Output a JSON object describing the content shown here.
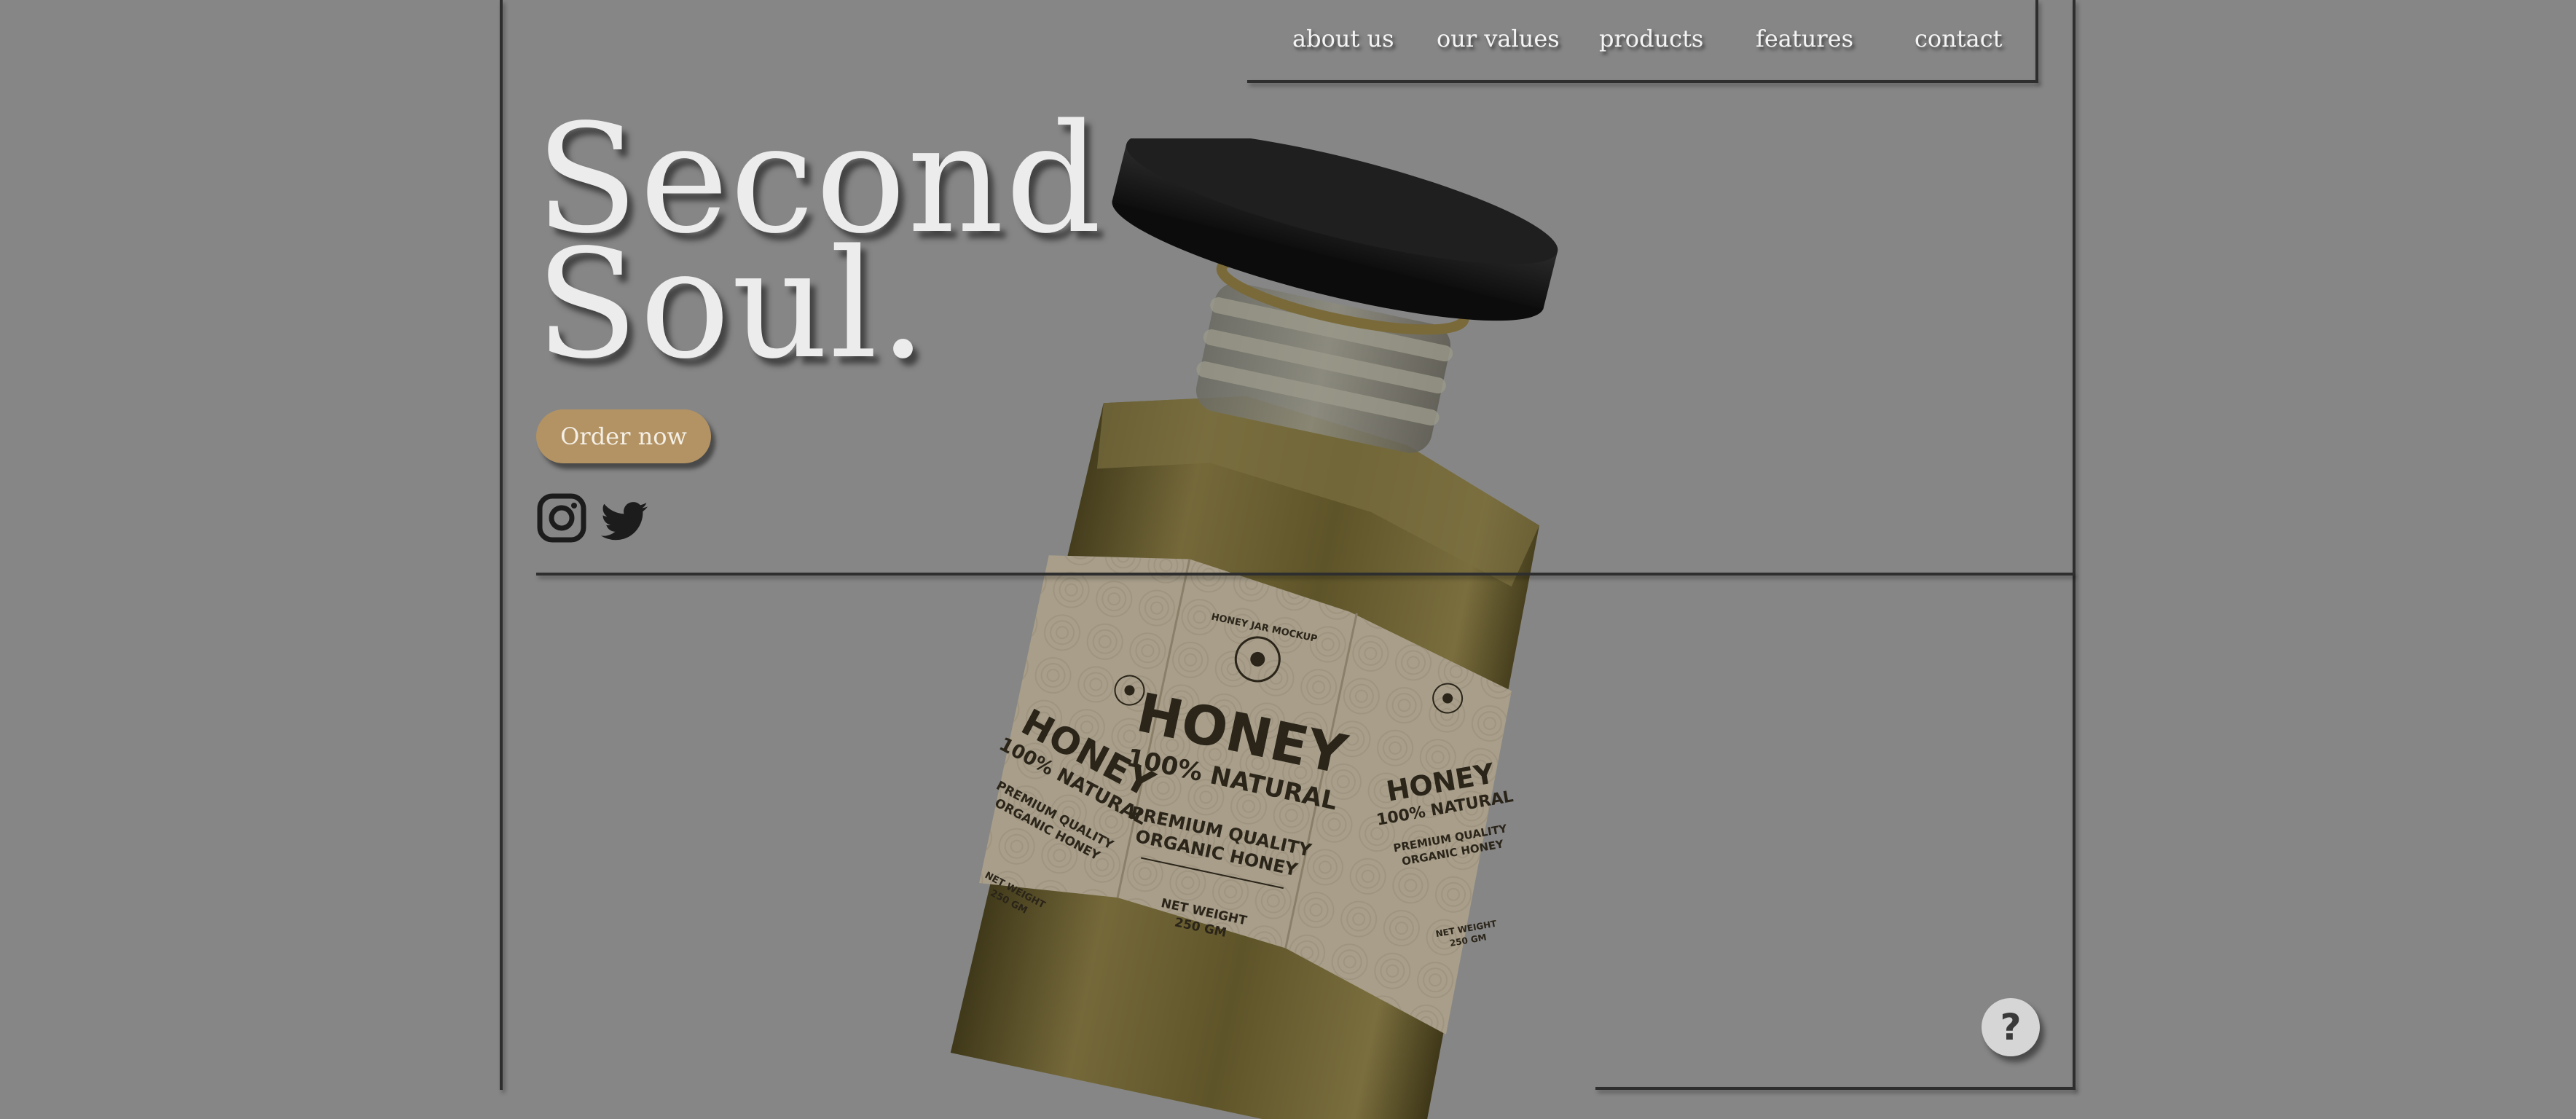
{
  "nav": {
    "items": [
      {
        "label": "about us"
      },
      {
        "label": "our values"
      },
      {
        "label": "products"
      },
      {
        "label": "features"
      },
      {
        "label": "contact"
      }
    ]
  },
  "hero": {
    "title_line1": "Second",
    "title_line2": "Soul.",
    "cta_label": "Order now"
  },
  "social": {
    "icons": [
      "instagram-icon",
      "twitter-icon"
    ]
  },
  "product": {
    "brand_line": "HONEY JAR MOCKUP",
    "name": "HONEY",
    "subtitle": "100% NATURAL",
    "quality_line1": "PREMIUM QUALITY",
    "quality_line2": "ORGANIC HONEY",
    "weight_line1": "NET WEIGHT",
    "weight_line2": "250 GM"
  },
  "help": {
    "label": "?"
  },
  "colors": {
    "background": "#868686",
    "accent": "#b39363",
    "lid": "#1a1a1a",
    "honey": "#6b5f30",
    "label": "#a89e8a"
  }
}
